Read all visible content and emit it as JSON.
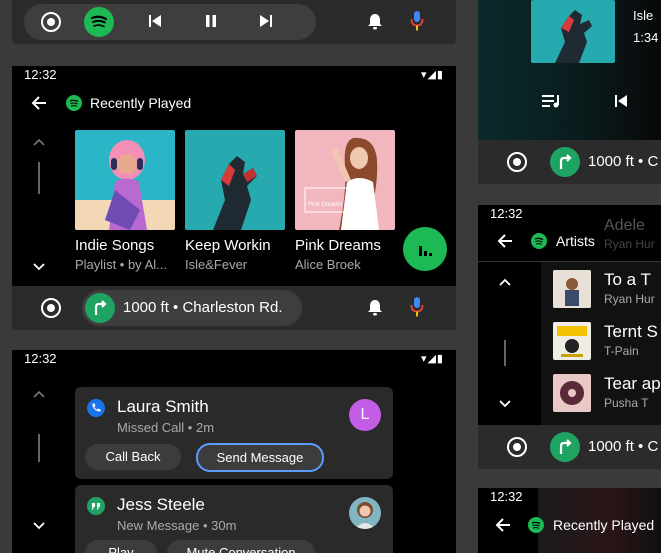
{
  "media_bar": {
    "spotify_icon": "spotify-icon"
  },
  "panel_main": {
    "status_time": "12:32",
    "header_title": "Recently Played",
    "albums": [
      {
        "title": "Indie Songs",
        "subtitle": "Playlist • by Al..."
      },
      {
        "title": "Keep Workin",
        "subtitle": "Isle&Fever"
      },
      {
        "title": "Pink Dreams",
        "subtitle": "Alice Broek",
        "cover_text": "Pink Dreams"
      }
    ]
  },
  "nav_bar_main": {
    "direction_text": "1000 ft • Charleston Rd."
  },
  "panel_notifications": {
    "status_time": "12:32",
    "cards": [
      {
        "name": "Laura Smith",
        "detail": "Missed Call • 2m",
        "actions": [
          "Call Back",
          "Send Message"
        ],
        "avatar_letter": "L"
      },
      {
        "name": "Jess Steele",
        "detail": "New Message • 30m",
        "actions": [
          "Play",
          "Mute Conversation"
        ]
      }
    ]
  },
  "panel_top_right": {
    "track_line1": "Isle",
    "track_line2": "1:34"
  },
  "nav_bar_top_right": {
    "direction_text": "1000 ft • C"
  },
  "panel_artists": {
    "status_time": "12:32",
    "header_title": "Artists",
    "ghost_name": "Adele",
    "ghost_sub": "Ryan Hur",
    "items": [
      {
        "title": "To a T",
        "subtitle": "Ryan Hur"
      },
      {
        "title": "Ternt S",
        "subtitle": "T-Pain"
      },
      {
        "title": "Tear ap",
        "subtitle": "Pusha T"
      }
    ]
  },
  "nav_bar_artists": {
    "direction_text": "1000 ft • C"
  },
  "panel_bottom_right": {
    "status_time": "12:32",
    "header_title": "Recently Played"
  },
  "colors": {
    "spotify_green": "#1db954",
    "call_blue": "#1a73e8",
    "avatar_purple": "#c45de6",
    "outline_blue": "#5a9cff"
  }
}
